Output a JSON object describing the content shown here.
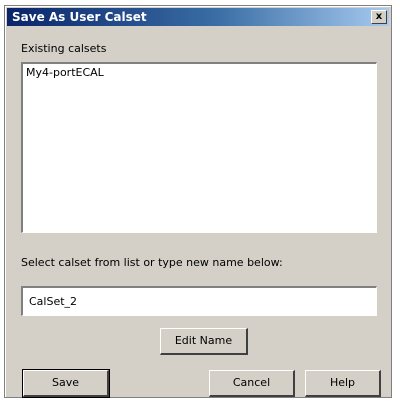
{
  "window": {
    "title": "Save As User Calset",
    "close_glyph": "x"
  },
  "existing": {
    "label": "Existing calsets",
    "items": [
      "My4-portECAL"
    ]
  },
  "instruction": "Select calset from list or type new name below:",
  "name_field": {
    "value": "CalSet_2"
  },
  "buttons": {
    "edit_name": "Edit Name",
    "save": "Save",
    "cancel": "Cancel",
    "help": "Help"
  }
}
